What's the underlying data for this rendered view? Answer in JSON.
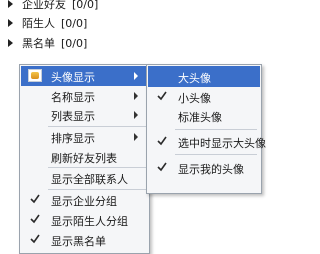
{
  "contact_groups": [
    {
      "name": "企业好友",
      "count": "[0/0]"
    },
    {
      "name": "陌生人",
      "count": "[0/0]"
    },
    {
      "name": "黑名单",
      "count": "[0/0]"
    }
  ],
  "context_menu": {
    "items": [
      {
        "label": "头像显示",
        "checked": false
      },
      {
        "label": "名称显示",
        "checked": false
      },
      {
        "label": "列表显示",
        "checked": false
      },
      {
        "label": "排序显示",
        "checked": false
      },
      {
        "label": "刷新好友列表",
        "checked": false
      },
      {
        "label": "显示全部联系人",
        "checked": false
      },
      {
        "label": "显示企业分组",
        "checked": true
      },
      {
        "label": "显示陌生人分组",
        "checked": true
      },
      {
        "label": "显示黑名单",
        "checked": true
      }
    ]
  },
  "avatar_submenu": {
    "items": [
      {
        "label": "大头像",
        "checked": false
      },
      {
        "label": "小头像",
        "checked": true
      },
      {
        "label": "标准头像",
        "checked": false
      },
      {
        "label": "选中时显示大头像",
        "checked": true
      },
      {
        "label": "显示我的头像",
        "checked": true
      }
    ]
  }
}
